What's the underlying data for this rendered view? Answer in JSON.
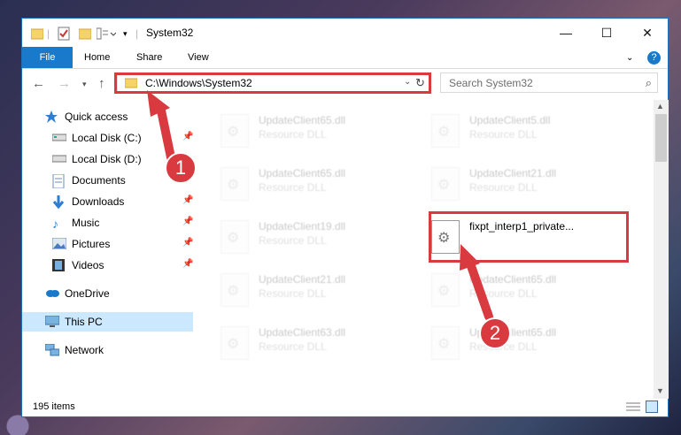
{
  "window": {
    "title": "System32",
    "minimize": "—",
    "maximize": "☐",
    "close": "✕"
  },
  "ribbon": {
    "file": "File",
    "home": "Home",
    "share": "Share",
    "view": "View",
    "help": "?"
  },
  "address": {
    "path": "C:\\Windows\\System32",
    "search_placeholder": "Search System32"
  },
  "nav": [
    {
      "label": "Quick access",
      "icon": "star-icon"
    },
    {
      "label": "Local Disk (C:)",
      "icon": "drive-icon",
      "pinned": true
    },
    {
      "label": "Local Disk (D:)",
      "icon": "drive-icon"
    },
    {
      "label": "Documents",
      "icon": "documents-icon"
    },
    {
      "label": "Downloads",
      "icon": "download-icon",
      "pinned": true
    },
    {
      "label": "Music",
      "icon": "music-icon",
      "pinned": true
    },
    {
      "label": "Pictures",
      "icon": "pictures-icon",
      "pinned": true
    },
    {
      "label": "Videos",
      "icon": "videos-icon",
      "pinned": true
    },
    {
      "label": "OneDrive",
      "icon": "cloud-icon"
    },
    {
      "label": "This PC",
      "icon": "computer-icon",
      "selected": true
    },
    {
      "label": "Network",
      "icon": "network-icon"
    }
  ],
  "files": [
    {
      "name": "UpdateClient65.dll",
      "type": "Resource DLL"
    },
    {
      "name": "UpdateClient5.dll",
      "type": "Resource DLL"
    },
    {
      "name": "UpdateClient65.dll",
      "type": "Resource DLL"
    },
    {
      "name": "UpdateClient21.dll",
      "type": "Resource DLL"
    },
    {
      "name": "UpdateClient19.dll",
      "type": "Resource DLL"
    },
    {
      "name": "fixpt_interp1_private...",
      "type": ""
    },
    {
      "name": "UpdateClient21.dll",
      "type": "Resource DLL"
    },
    {
      "name": "UpdateClient65.dll",
      "type": "Resource DLL"
    },
    {
      "name": "UpdateClient63.dll",
      "type": "Resource DLL"
    },
    {
      "name": "UpdateClient65.dll",
      "type": "Resource DLL"
    }
  ],
  "status": {
    "item_count": "195 items"
  },
  "callouts": [
    "1",
    "2"
  ],
  "colors": {
    "accent": "#1979ca",
    "highlight": "#d83a3f",
    "selection": "#cce8ff"
  }
}
